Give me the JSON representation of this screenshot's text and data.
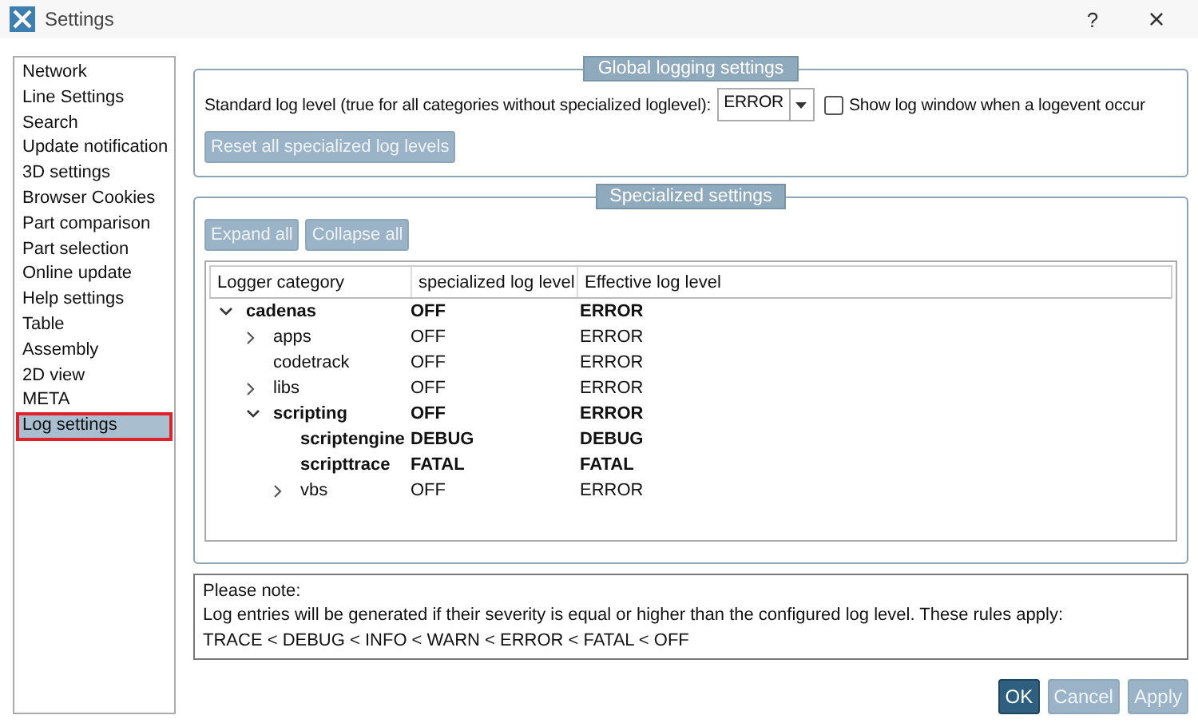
{
  "window": {
    "title": "Settings",
    "help": "?",
    "close": "×"
  },
  "sidebar": {
    "items": [
      {
        "label": "Network",
        "selected": false
      },
      {
        "label": "Line Settings",
        "selected": false
      },
      {
        "label": "Search",
        "selected": false
      },
      {
        "label": "Update notification",
        "selected": false
      },
      {
        "label": "3D settings",
        "selected": false
      },
      {
        "label": "Browser Cookies",
        "selected": false
      },
      {
        "label": "Part comparison",
        "selected": false
      },
      {
        "label": "Part selection",
        "selected": false
      },
      {
        "label": "Online update",
        "selected": false
      },
      {
        "label": "Help settings",
        "selected": false
      },
      {
        "label": "Table",
        "selected": false
      },
      {
        "label": "Assembly",
        "selected": false
      },
      {
        "label": "2D view",
        "selected": false
      },
      {
        "label": "META",
        "selected": false
      },
      {
        "label": "Log settings",
        "selected": true
      }
    ]
  },
  "global": {
    "title": "Global logging settings",
    "label": "Standard log level (true for all categories without specialized loglevel):",
    "level": "ERROR",
    "checkbox": {
      "label": "Show log window when a logevent occur",
      "checked": false
    },
    "reset": {
      "label": "Reset all specialized log levels",
      "disabled": true
    }
  },
  "specialized": {
    "title": "Specialized settings",
    "buttons": [
      {
        "label": "Expand all",
        "disabled": true
      },
      {
        "label": "Collapse all",
        "disabled": true
      }
    ],
    "columns": [
      "Logger category",
      "specialized log level",
      "Effective log level"
    ],
    "tree": [
      {
        "name": "cadenas",
        "specialized": "OFF",
        "effective": "ERROR",
        "bold": true,
        "expanded": true,
        "children": [
          {
            "name": "apps",
            "specialized": "OFF",
            "effective": "ERROR",
            "bold": false,
            "expanded": false
          },
          {
            "name": "codetrack",
            "specialized": "OFF",
            "effective": "ERROR",
            "bold": false
          },
          {
            "name": "libs",
            "specialized": "OFF",
            "effective": "ERROR",
            "bold": false,
            "expanded": false
          },
          {
            "name": "scripting",
            "specialized": "OFF",
            "effective": "ERROR",
            "bold": true,
            "expanded": true,
            "children": [
              {
                "name": "scriptengine",
                "specialized": "DEBUG",
                "effective": "DEBUG",
                "bold": true
              },
              {
                "name": "scripttrace",
                "specialized": "FATAL",
                "effective": "FATAL",
                "bold": true
              },
              {
                "name": "vbs",
                "specialized": "OFF",
                "effective": "ERROR",
                "bold": false,
                "expanded": false
              }
            ]
          }
        ]
      }
    ]
  },
  "note": [
    "Please note:",
    "Log entries will be generated if their severity is equal or higher than the configured log level. These rules apply:",
    "TRACE < DEBUG < INFO < WARN < ERROR < FATAL < OFF"
  ],
  "buttons": [
    {
      "label": "OK",
      "disabled": false
    },
    {
      "label": "Cancel",
      "disabled": true
    },
    {
      "label": "Apply",
      "disabled": true
    }
  ]
}
